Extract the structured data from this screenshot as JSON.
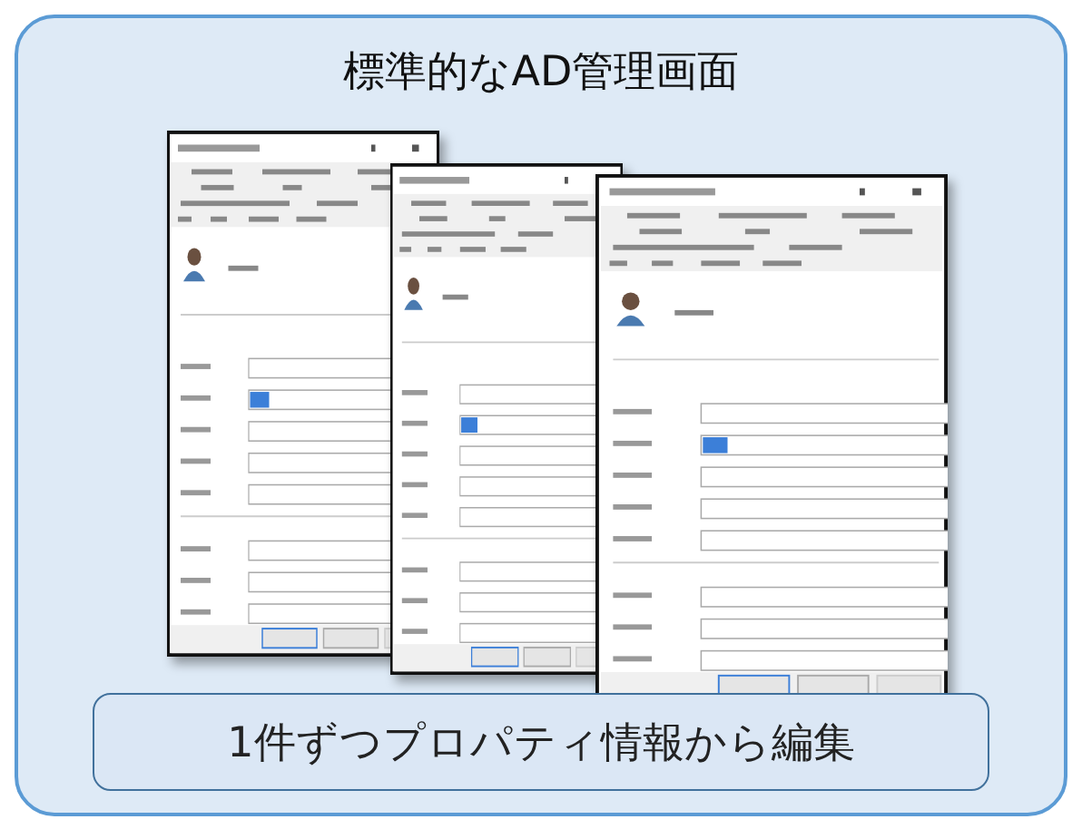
{
  "title": "標準的なAD管理画面",
  "caption": "1件ずつプロパティ情報から編集"
}
